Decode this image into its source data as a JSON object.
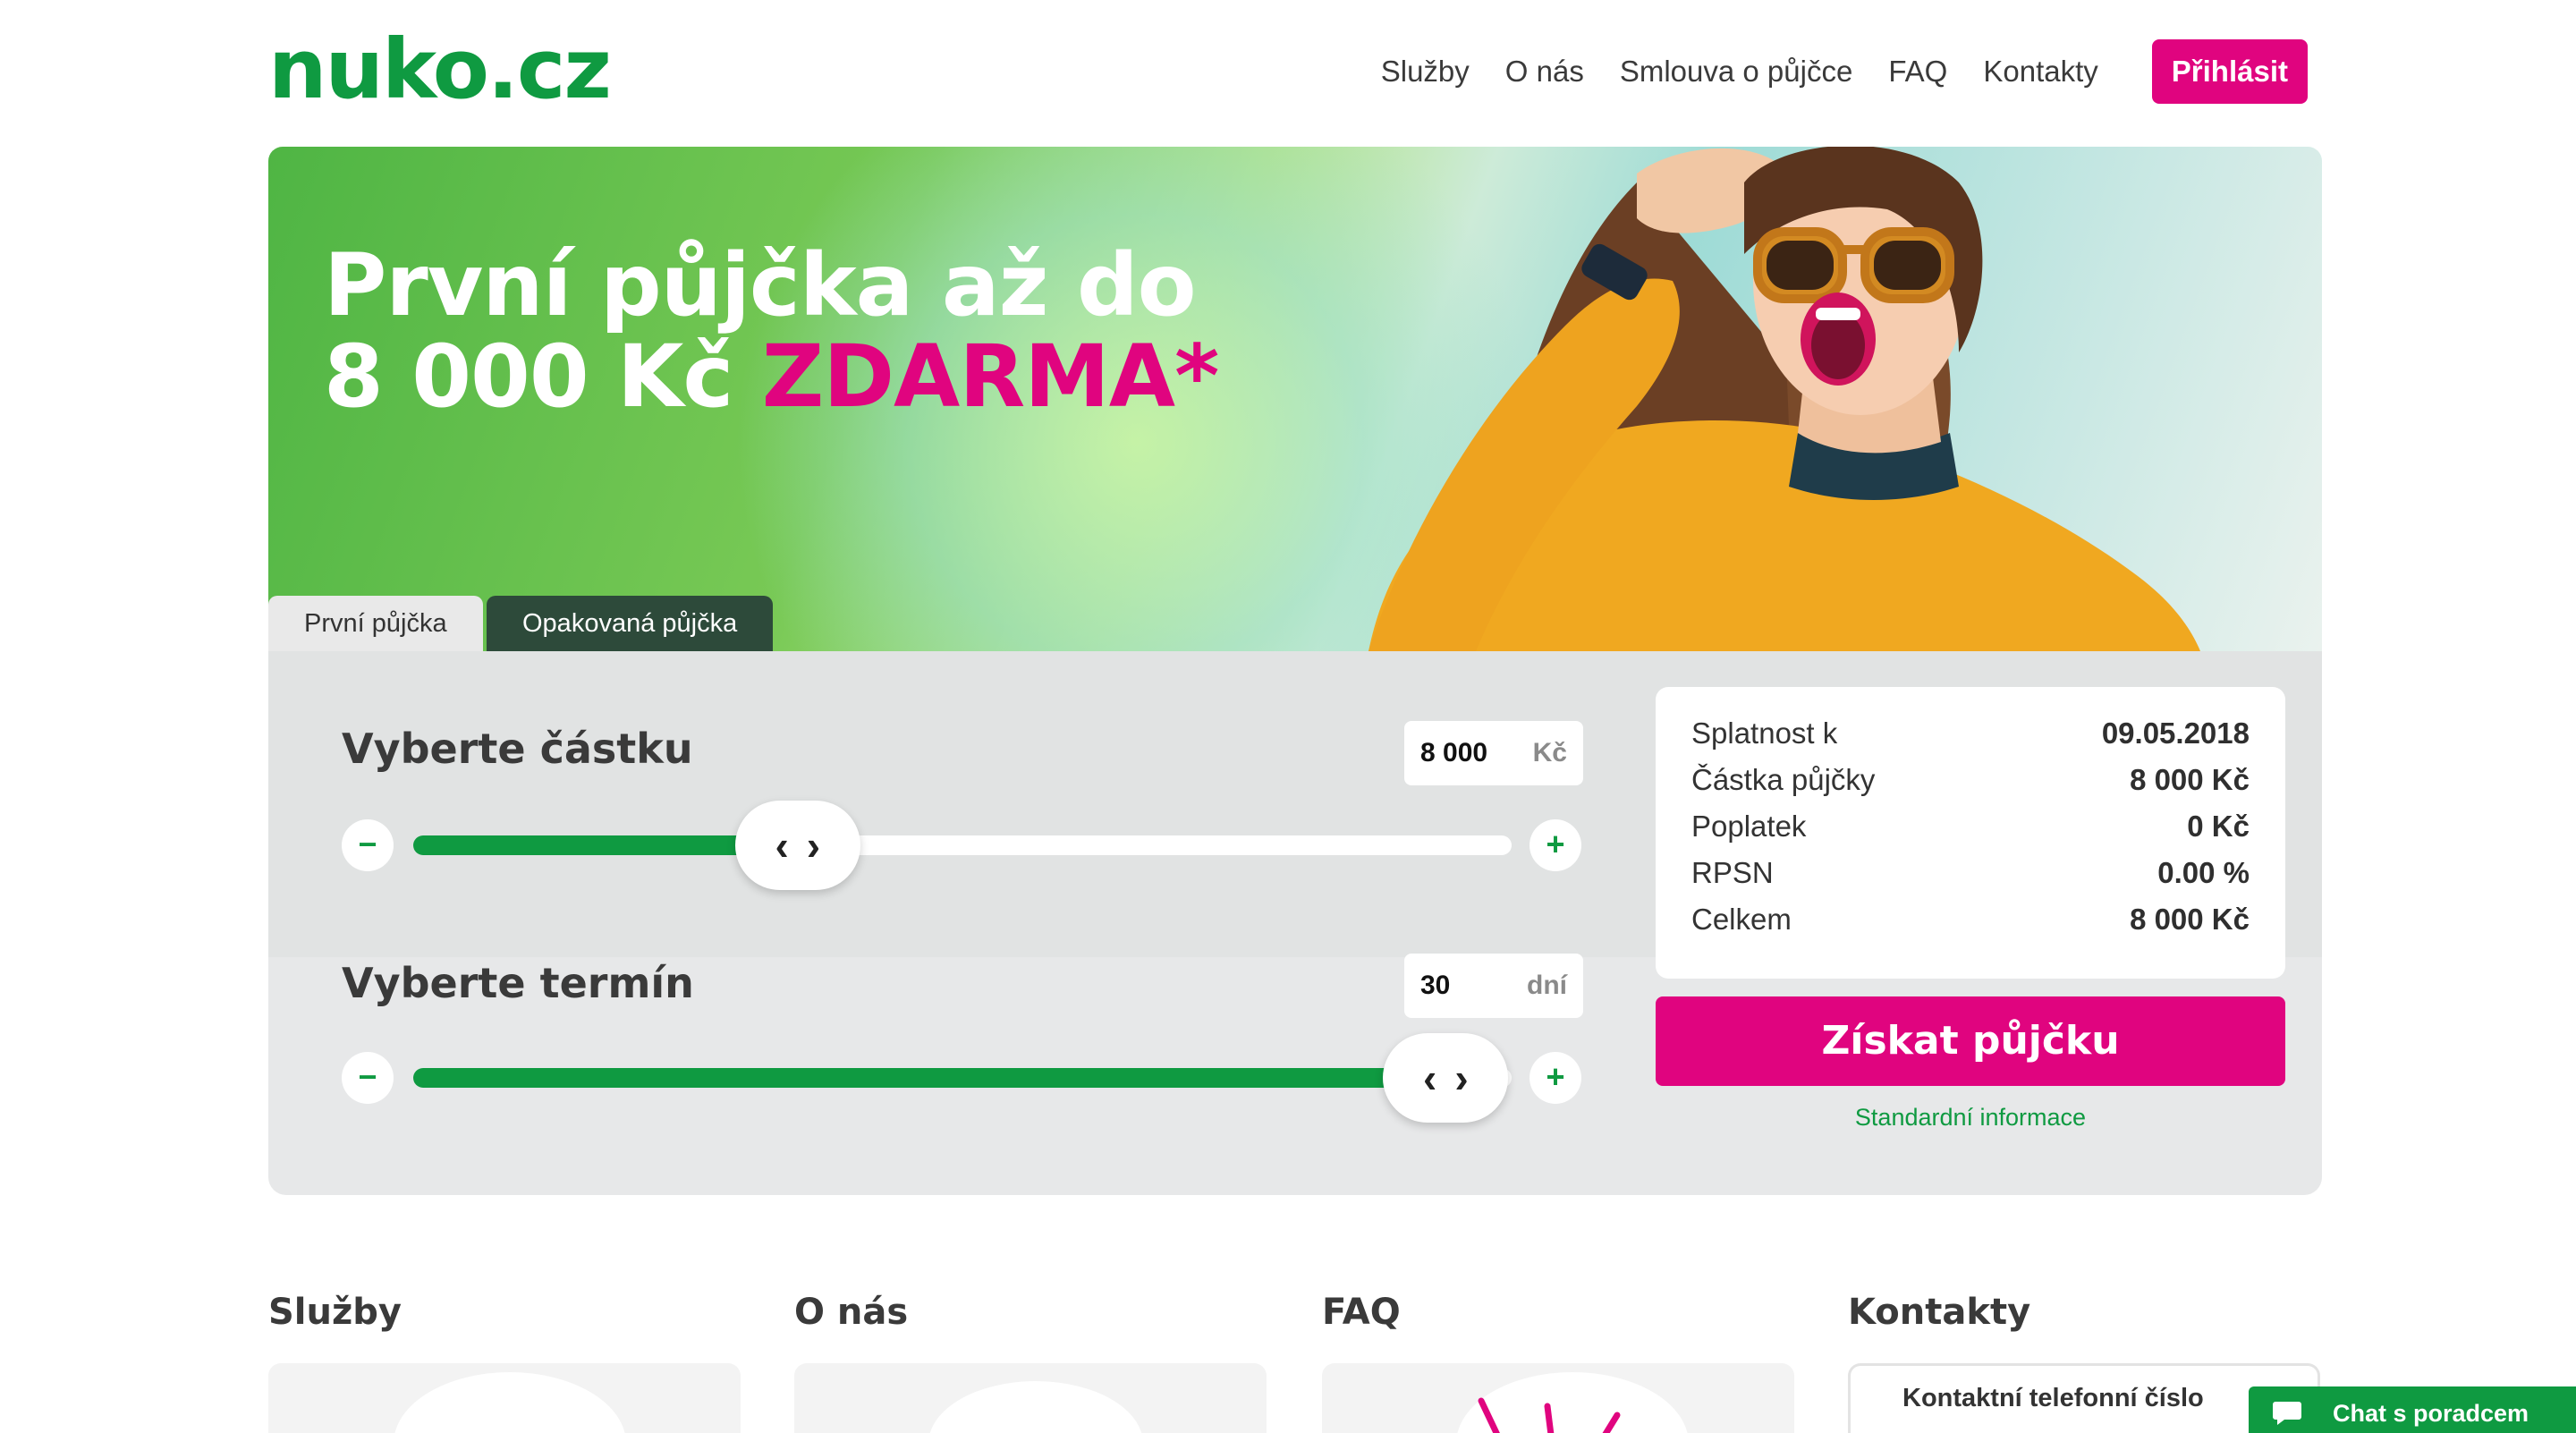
{
  "brand": {
    "logo_text": "nuko.cz",
    "primary_green": "#0f9a41",
    "accent_pink": "#e0047f"
  },
  "nav": {
    "items": [
      "Služby",
      "O nás",
      "Smlouva o půjčce",
      "FAQ",
      "Kontakty"
    ],
    "login_label": "Přihlásit"
  },
  "hero": {
    "title_line1": "První půjčka až do",
    "title_line2_white": "8 000 Kč ",
    "title_line2_pink": "ZDARMA*",
    "tabs": [
      "První půjčka",
      "Opakovaná půjčka"
    ]
  },
  "calculator": {
    "amount": {
      "label": "Vyberte částku",
      "value": "8 000",
      "unit": "Kč",
      "slider_fraction": 0.35
    },
    "term": {
      "label": "Vyberte termín",
      "value": "30",
      "unit": "dní",
      "slider_fraction": 0.94
    },
    "minus_symbol": "−",
    "plus_symbol": "+",
    "handle_left": "‹",
    "handle_right": "›"
  },
  "summary": {
    "rows": [
      {
        "label": "Splatnost k",
        "value": "09.05.2018"
      },
      {
        "label": "Částka půjčky",
        "value": "8 000 Kč"
      },
      {
        "label": "Poplatek",
        "value": "0 Kč"
      },
      {
        "label": "RPSN",
        "value": "0.00 %"
      },
      {
        "label": "Celkem",
        "value": "8 000 Kč"
      }
    ],
    "cta_label": "Získat půjčku",
    "info_link": "Standardní informace"
  },
  "sections": {
    "titles": [
      "Služby",
      "O nás",
      "FAQ",
      "Kontakty"
    ],
    "contact_card_text": "Kontaktní telefonní číslo"
  },
  "chat": {
    "label": "Chat s poradcem",
    "icon": "chat-bubble-icon"
  }
}
